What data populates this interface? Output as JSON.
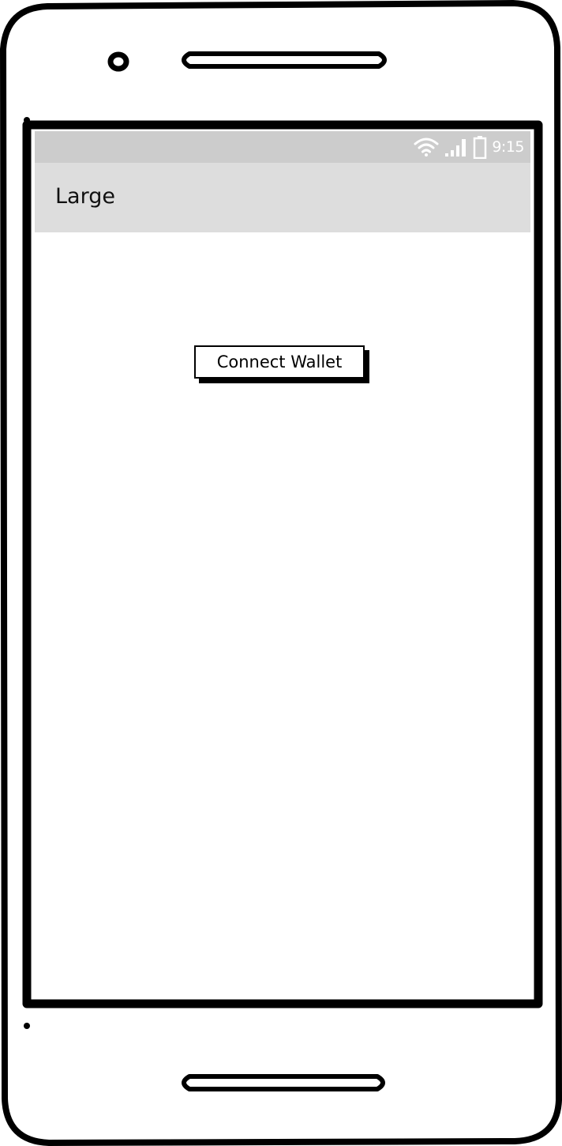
{
  "status_bar": {
    "time": "9:15",
    "icons": [
      "wifi-icon",
      "signal-icon",
      "battery-icon"
    ],
    "text_color": "#ffffff",
    "background": "#cccccc"
  },
  "app_bar": {
    "title": "Large",
    "background": "#dddddd"
  },
  "main": {
    "connect_button_label": "Connect Wallet"
  }
}
